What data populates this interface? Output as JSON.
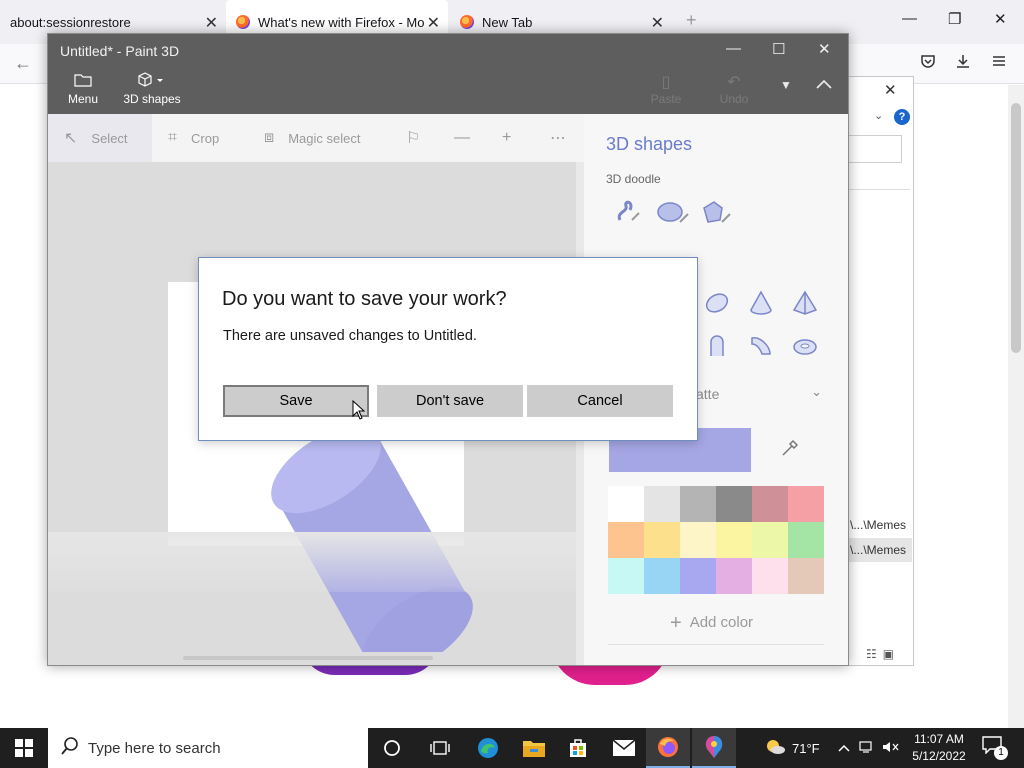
{
  "firefox": {
    "tabs": [
      {
        "label": "about:sessionrestore",
        "close": "✕",
        "active": false
      },
      {
        "label": "What's new with Firefox - More",
        "close": "✕",
        "active": true
      },
      {
        "label": "New Tab",
        "close": "✕",
        "active": false
      }
    ],
    "new_tab_icon": "plus-icon",
    "new_tab_glyph": "+",
    "window_controls": {
      "minimize": "—",
      "restore": "❐",
      "close": "✕"
    },
    "toolbar": {
      "back": "←",
      "pocket": "pocket-icon",
      "download": "download-icon",
      "menu": "hamburger-icon"
    }
  },
  "explorer": {
    "close": "✕",
    "help": "?",
    "rows": [
      {
        "text": "\\...\\Memes",
        "selected": false
      },
      {
        "text": "\\...\\Memes",
        "selected": true
      }
    ]
  },
  "paint": {
    "title": "Untitled* - Paint 3D",
    "window_controls": {
      "minimize": "—",
      "maximize": "☐",
      "close": "✕"
    },
    "top_menu": [
      {
        "label": "Menu",
        "icon": "folder-icon"
      },
      {
        "label": "3D shapes",
        "icon": "cube-icon"
      }
    ],
    "ghost_buttons": [
      {
        "label": "Paste",
        "icon": "paste-icon"
      },
      {
        "label": "Undo",
        "icon": "undo-icon"
      }
    ],
    "tools": [
      {
        "label": "Select",
        "icon": "select-cursor-icon"
      },
      {
        "label": "Crop",
        "icon": "crop-icon"
      },
      {
        "label": "Magic select",
        "icon": "magic-select-icon"
      }
    ],
    "panel": {
      "title": "3D shapes",
      "subtitle": "3D doodle",
      "dropdown_text": "atte",
      "add_color": "Add color",
      "selected_color": "#a5a6e4",
      "swatches": [
        "#ffffff",
        "#e4e4e4",
        "#b4b4b4",
        "#8a8a8a",
        "#d09098",
        "#f4a0a4",
        "#fdc490",
        "#fde08c",
        "#fdf4c8",
        "#fbf4a0",
        "#ecf8a8",
        "#a4e4a4",
        "#c8f8f4",
        "#98d4f4",
        "#a8a8f0",
        "#e4b0e4",
        "#fde0ec",
        "#e4c8b8"
      ]
    }
  },
  "dialog": {
    "title": "Do you want to save your work?",
    "message": "There are unsaved changes to Untitled.",
    "buttons": {
      "save": "Save",
      "dont_save": "Don't save",
      "cancel": "Cancel"
    }
  },
  "taskbar": {
    "search_placeholder": "Type here to search",
    "weather": "71°F",
    "time": "11:07 AM",
    "date": "5/12/2022",
    "notifications": "1",
    "pinned": [
      "cortana-icon",
      "task-view-icon",
      "edge-icon",
      "file-explorer-icon",
      "store-icon",
      "mail-icon",
      "firefox-icon",
      "paint-3d-icon"
    ]
  }
}
